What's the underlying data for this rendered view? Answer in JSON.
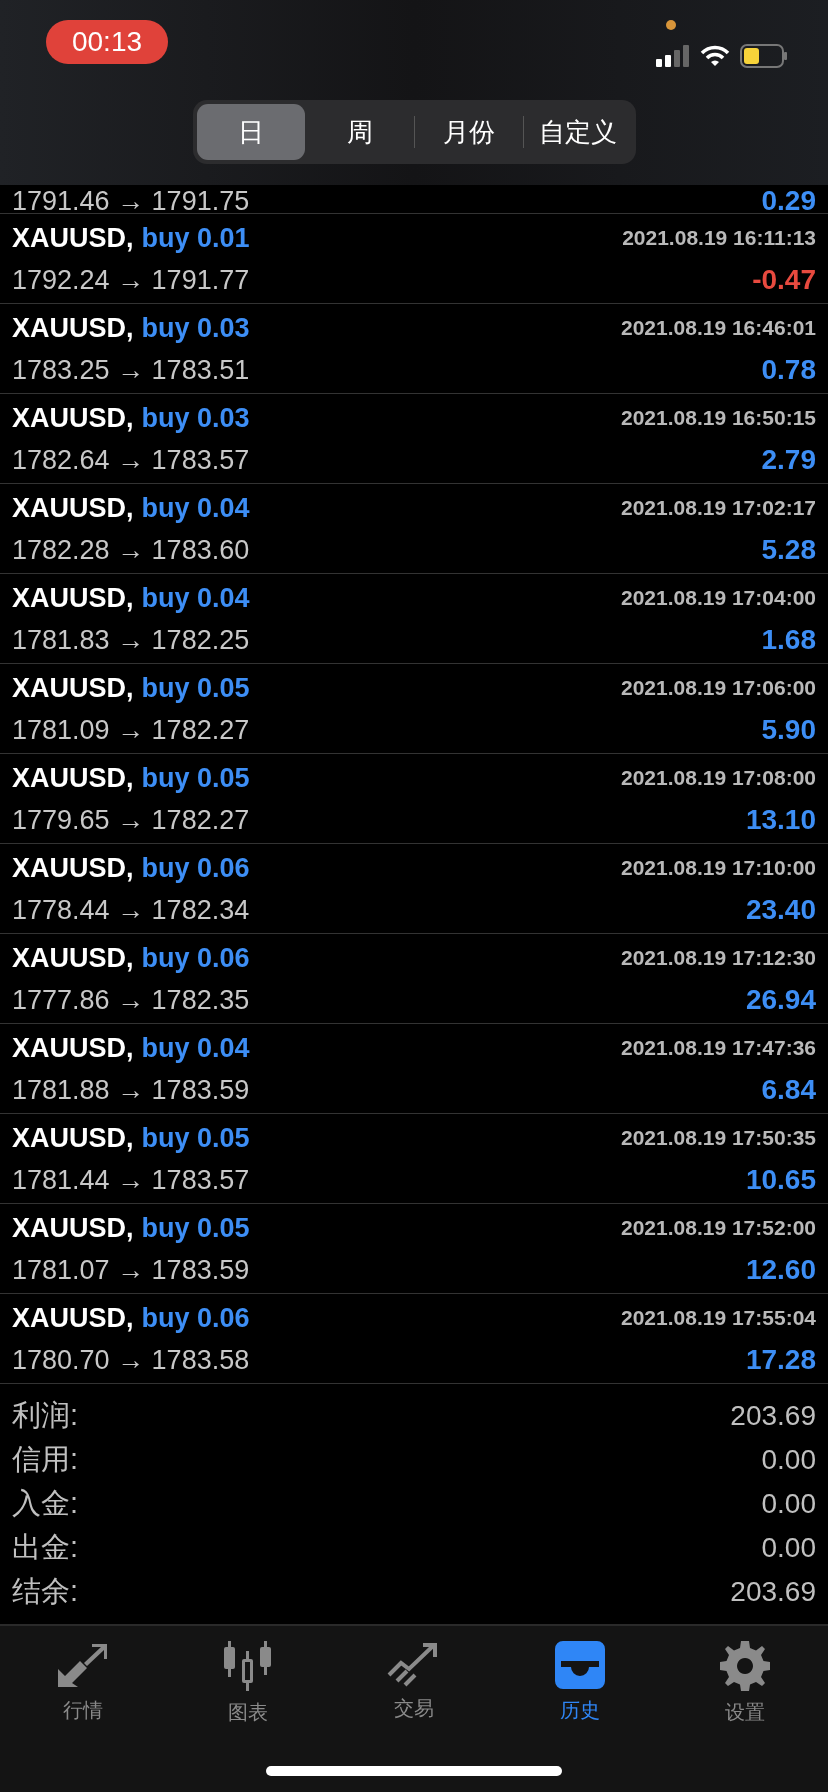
{
  "status_bar": {
    "recording_time": "00:13"
  },
  "period_tabs": [
    {
      "label": "日",
      "selected": true
    },
    {
      "label": "周",
      "selected": false
    },
    {
      "label": "月份",
      "selected": false
    },
    {
      "label": "自定义",
      "selected": false
    }
  ],
  "partial_row": {
    "prices": "1791.46 → 1791.75",
    "profit": "0.29",
    "loss": false
  },
  "deals": [
    {
      "symbol": "XAUUSD,",
      "side": "buy 0.01",
      "time": "2021.08.19 16:11:13",
      "prices": "1792.24 → 1791.77",
      "profit": "-0.47",
      "loss": true
    },
    {
      "symbol": "XAUUSD,",
      "side": "buy 0.03",
      "time": "2021.08.19 16:46:01",
      "prices": "1783.25 → 1783.51",
      "profit": "0.78",
      "loss": false
    },
    {
      "symbol": "XAUUSD,",
      "side": "buy 0.03",
      "time": "2021.08.19 16:50:15",
      "prices": "1782.64 → 1783.57",
      "profit": "2.79",
      "loss": false
    },
    {
      "symbol": "XAUUSD,",
      "side": "buy 0.04",
      "time": "2021.08.19 17:02:17",
      "prices": "1782.28 → 1783.60",
      "profit": "5.28",
      "loss": false
    },
    {
      "symbol": "XAUUSD,",
      "side": "buy 0.04",
      "time": "2021.08.19 17:04:00",
      "prices": "1781.83 → 1782.25",
      "profit": "1.68",
      "loss": false
    },
    {
      "symbol": "XAUUSD,",
      "side": "buy 0.05",
      "time": "2021.08.19 17:06:00",
      "prices": "1781.09 → 1782.27",
      "profit": "5.90",
      "loss": false
    },
    {
      "symbol": "XAUUSD,",
      "side": "buy 0.05",
      "time": "2021.08.19 17:08:00",
      "prices": "1779.65 → 1782.27",
      "profit": "13.10",
      "loss": false
    },
    {
      "symbol": "XAUUSD,",
      "side": "buy 0.06",
      "time": "2021.08.19 17:10:00",
      "prices": "1778.44 → 1782.34",
      "profit": "23.40",
      "loss": false
    },
    {
      "symbol": "XAUUSD,",
      "side": "buy 0.06",
      "time": "2021.08.19 17:12:30",
      "prices": "1777.86 → 1782.35",
      "profit": "26.94",
      "loss": false
    },
    {
      "symbol": "XAUUSD,",
      "side": "buy 0.04",
      "time": "2021.08.19 17:47:36",
      "prices": "1781.88 → 1783.59",
      "profit": "6.84",
      "loss": false
    },
    {
      "symbol": "XAUUSD,",
      "side": "buy 0.05",
      "time": "2021.08.19 17:50:35",
      "prices": "1781.44 → 1783.57",
      "profit": "10.65",
      "loss": false
    },
    {
      "symbol": "XAUUSD,",
      "side": "buy 0.05",
      "time": "2021.08.19 17:52:00",
      "prices": "1781.07 → 1783.59",
      "profit": "12.60",
      "loss": false
    },
    {
      "symbol": "XAUUSD,",
      "side": "buy 0.06",
      "time": "2021.08.19 17:55:04",
      "prices": "1780.70 → 1783.58",
      "profit": "17.28",
      "loss": false
    }
  ],
  "summary": [
    {
      "label": "利润:",
      "value": "203.69"
    },
    {
      "label": "信用:",
      "value": "0.00"
    },
    {
      "label": "入金:",
      "value": "0.00"
    },
    {
      "label": "出金:",
      "value": "0.00"
    },
    {
      "label": "结余:",
      "value": "203.69"
    }
  ],
  "bottom_tabs": [
    {
      "kind": "quotes",
      "label": "行情",
      "selected": false
    },
    {
      "kind": "chart",
      "label": "图表",
      "selected": false
    },
    {
      "kind": "trade",
      "label": "交易",
      "selected": false
    },
    {
      "kind": "history",
      "label": "历史",
      "selected": true
    },
    {
      "kind": "settings",
      "label": "设置",
      "selected": false
    }
  ]
}
